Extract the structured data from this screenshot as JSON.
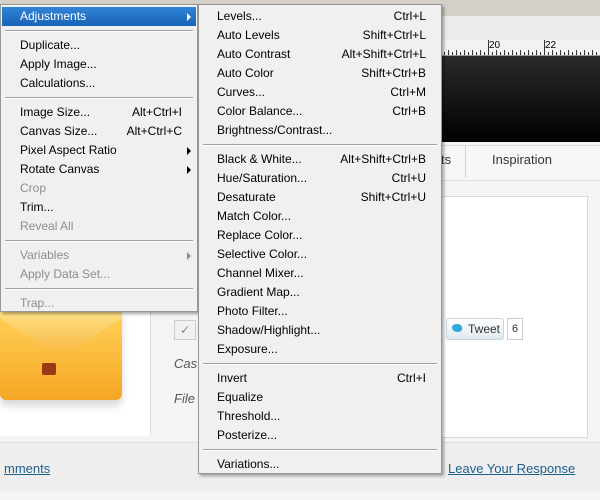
{
  "background": {
    "ruler_labels": [
      "20",
      "22"
    ],
    "nav_partial": "ts",
    "nav_tab": "Inspiration",
    "checkmark": "✓",
    "cas_text": "Cas",
    "file_text": "File",
    "tweet_label": "Tweet",
    "tweet_count": "6",
    "comments_link": "mments",
    "leave_response_link": "Leave Your Response"
  },
  "image_menu": [
    {
      "label": "Adjustments",
      "submenu": true,
      "highlighted": true
    },
    {
      "separator": true
    },
    {
      "label": "Duplicate..."
    },
    {
      "label": "Apply Image..."
    },
    {
      "label": "Calculations..."
    },
    {
      "separator": true
    },
    {
      "label": "Image Size...",
      "shortcut": "Alt+Ctrl+I"
    },
    {
      "label": "Canvas Size...",
      "shortcut": "Alt+Ctrl+C"
    },
    {
      "label": "Pixel Aspect Ratio",
      "submenu": true
    },
    {
      "label": "Rotate Canvas",
      "submenu": true
    },
    {
      "label": "Crop",
      "disabled": true
    },
    {
      "label": "Trim..."
    },
    {
      "label": "Reveal All",
      "disabled": true
    },
    {
      "separator": true
    },
    {
      "label": "Variables",
      "submenu": true,
      "disabled": true
    },
    {
      "label": "Apply Data Set...",
      "disabled": true
    },
    {
      "separator": true
    },
    {
      "label": "Trap...",
      "disabled": true
    }
  ],
  "adjustments_menu": [
    {
      "label": "Levels...",
      "shortcut": "Ctrl+L"
    },
    {
      "label": "Auto Levels",
      "shortcut": "Shift+Ctrl+L"
    },
    {
      "label": "Auto Contrast",
      "shortcut": "Alt+Shift+Ctrl+L"
    },
    {
      "label": "Auto Color",
      "shortcut": "Shift+Ctrl+B"
    },
    {
      "label": "Curves...",
      "shortcut": "Ctrl+M"
    },
    {
      "label": "Color Balance...",
      "shortcut": "Ctrl+B"
    },
    {
      "label": "Brightness/Contrast..."
    },
    {
      "separator": true
    },
    {
      "label": "Black & White...",
      "shortcut": "Alt+Shift+Ctrl+B"
    },
    {
      "label": "Hue/Saturation...",
      "shortcut": "Ctrl+U"
    },
    {
      "label": "Desaturate",
      "shortcut": "Shift+Ctrl+U"
    },
    {
      "label": "Match Color..."
    },
    {
      "label": "Replace Color..."
    },
    {
      "label": "Selective Color..."
    },
    {
      "label": "Channel Mixer..."
    },
    {
      "label": "Gradient Map..."
    },
    {
      "label": "Photo Filter..."
    },
    {
      "label": "Shadow/Highlight..."
    },
    {
      "label": "Exposure..."
    },
    {
      "separator": true
    },
    {
      "label": "Invert",
      "shortcut": "Ctrl+I"
    },
    {
      "label": "Equalize"
    },
    {
      "label": "Threshold..."
    },
    {
      "label": "Posterize..."
    },
    {
      "separator": true
    },
    {
      "label": "Variations..."
    }
  ]
}
